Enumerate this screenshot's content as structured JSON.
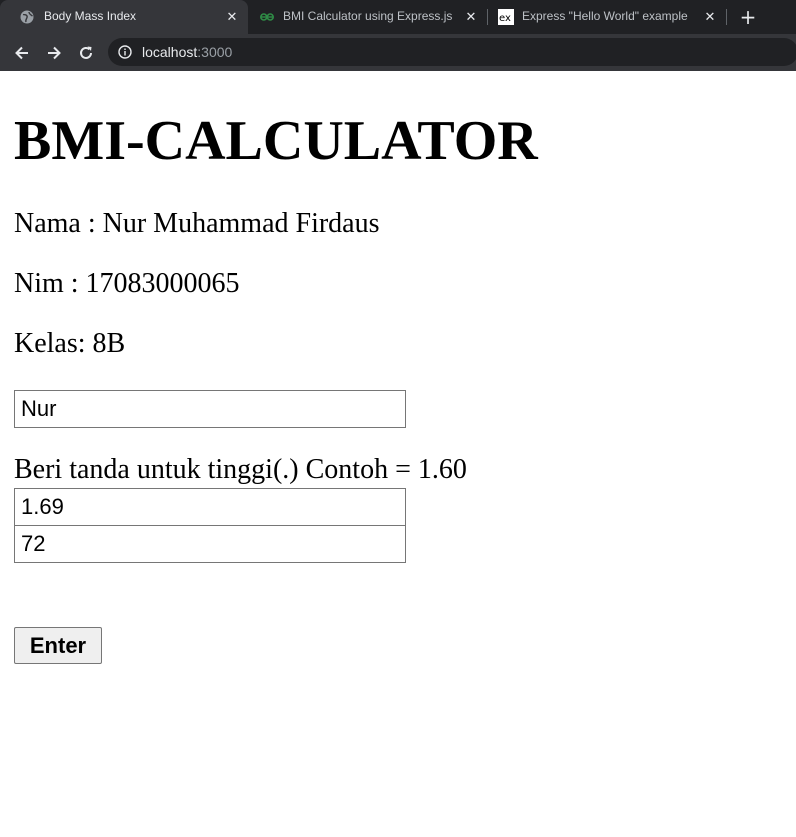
{
  "browser": {
    "tabs": [
      {
        "title": "Body Mass Index",
        "icon": "globe-icon",
        "active": true
      },
      {
        "title": "BMI Calculator using Express.js -",
        "icon": "geeksforgeeks-icon",
        "active": false
      },
      {
        "title": "Express \"Hello World\" example",
        "icon": "express-ex-icon",
        "active": false
      }
    ],
    "address": {
      "host": "localhost",
      "port": ":3000"
    }
  },
  "page": {
    "heading": "BMI-CALCULATOR",
    "nama": "Nama : Nur Muhammad Firdaus",
    "nim": "Nim : 17083000065",
    "kelas": "Kelas: 8B",
    "name_input": "Nur",
    "hint": "Beri tanda untuk tinggi(.) Contoh = 1.60",
    "height_input": "1.69",
    "weight_input": "72",
    "submit_label": "Enter"
  },
  "colors": {
    "tabbar_bg": "#202124",
    "active_tab_bg": "#35363a",
    "page_bg": "#ffffff"
  }
}
